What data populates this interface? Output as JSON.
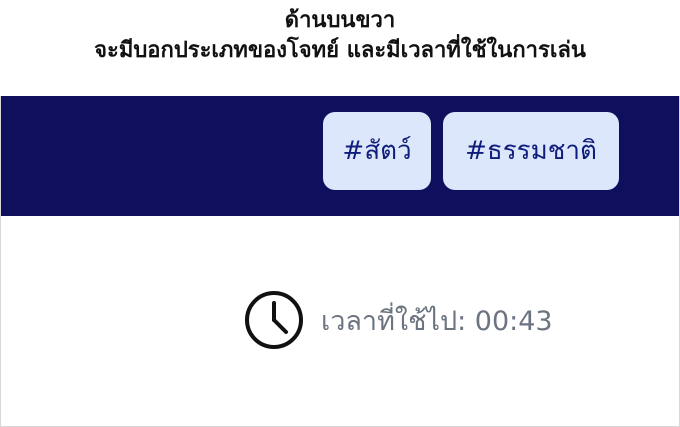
{
  "caption": {
    "line1": "ด้านบนขวา",
    "line2": "จะมีบอกประเภทของโจทย์ และมีเวลาที่ใช้ในการเล่น"
  },
  "tags": [
    {
      "label": "#สัตว์"
    },
    {
      "label": "#ธรรมชาติ"
    }
  ],
  "timer": {
    "label": "เวลาที่ใช้ไป: 00:43",
    "icon": "clock-icon"
  },
  "colors": {
    "bar": "#0f0f5e",
    "tag_bg": "#dde7fb",
    "tag_text": "#0f1d7a",
    "time_text": "#6b7480"
  }
}
